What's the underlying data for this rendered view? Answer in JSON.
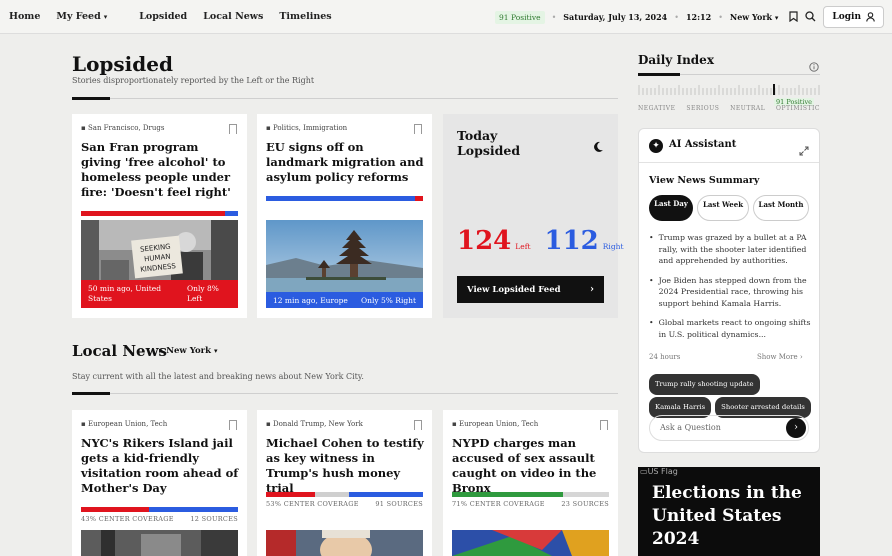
{
  "nav": {
    "home": "Home",
    "my_feed": "My Feed",
    "lopsided": "Lopsided",
    "local_news": "Local News",
    "timelines": "Timelines"
  },
  "status": {
    "positive": "91 Positive",
    "date": "Saturday, July 13, 2024",
    "time": "12:12",
    "city": "New York",
    "login": "Login"
  },
  "lopsided": {
    "title": "Lopsided",
    "subtitle": "Stories disproportionately reported by the Left or the Right",
    "cards": [
      {
        "tags": "San Francisco, Drugs",
        "headline": "San Fran program giving 'free alcohol' to homeless people under fire: 'Doesn't feel right'",
        "left_time": "50 min ago, United States",
        "right_text": "Only 8% Left",
        "left_pct": 0.92,
        "overlay_color": "#e0141e",
        "sign_text": "SEEKING HUMAN KINDNESS"
      },
      {
        "tags": "Politics, Immigration",
        "headline": "EU signs off on landmark migration and asylum policy reforms",
        "left_time": "12 min ago, Europe",
        "right_text": "Only 5% Right",
        "left_pct": 0.95,
        "overlay_color": "#2b5ce0"
      }
    ],
    "today": {
      "title_line1": "Today",
      "title_line2": "Lopsided",
      "left_count": "124",
      "left_label": "Left",
      "right_count": "112",
      "right_label": "Right",
      "button": "View Lopsided Feed"
    }
  },
  "local": {
    "title": "Local News",
    "city": "New York",
    "subtitle": "Stay current with all the latest and breaking news about New York City.",
    "cards": [
      {
        "tags": "European Union, Tech",
        "headline": "NYC's Rikers Island jail gets a kid-friendly visitation room ahead of Mother's Day",
        "coverage": "43% CENTER COVERAGE",
        "sources": "12 SOURCES",
        "split": [
          0.43,
          0.57
        ],
        "colors": [
          "#e0141e",
          "#2b5ce0"
        ]
      },
      {
        "tags": "Donald Trump, New York",
        "headline": "Michael Cohen to testify as key witness in Trump's hush money trial",
        "coverage": "53% CENTER COVERAGE",
        "sources": "91 SOURCES",
        "split": [
          0.31,
          0.22,
          0.47
        ],
        "colors": [
          "#e0141e",
          "#cfcfcf",
          "#2b5ce0"
        ]
      },
      {
        "tags": "European Union, Tech",
        "headline": "NYPD charges man accused of sex assault caught on video in the Bronx",
        "coverage": "71% CENTER COVERAGE",
        "sources": "23 SOURCES",
        "split": [
          0.71,
          0.29
        ],
        "colors": [
          "#2f9a3e",
          "#d6d6d6"
        ]
      }
    ]
  },
  "daily_index": {
    "title": "Daily Index",
    "marker_label": "91 Positive",
    "marker_value": 0.91,
    "scale": [
      "NEGATIVE",
      "SERIOUS",
      "NEUTRAL",
      "OPTIMISTIC"
    ]
  },
  "assistant": {
    "title": "AI Assistant",
    "summary_title": "View News Summary",
    "tabs": [
      "Last Day",
      "Last Week",
      "Last Month"
    ],
    "bullets": [
      "Trump was grazed by a bullet at a PA rally, with the shooter later identified and apprehended by authorities.",
      "Joe Biden has stepped down from the 2024 Presidential race, throwing his support behind Kamala Harris.",
      "Global markets react to ongoing shifts in U.S. political dynamics..."
    ],
    "age": "24 hours",
    "show_more": "Show More",
    "chips": [
      "Trump rally shooting update",
      "Kamala Harris",
      "Shooter arrested details"
    ],
    "ask_placeholder": "Ask a Question"
  },
  "elections": {
    "img_alt": "US Flag",
    "title": "Elections in the United States 2024"
  }
}
